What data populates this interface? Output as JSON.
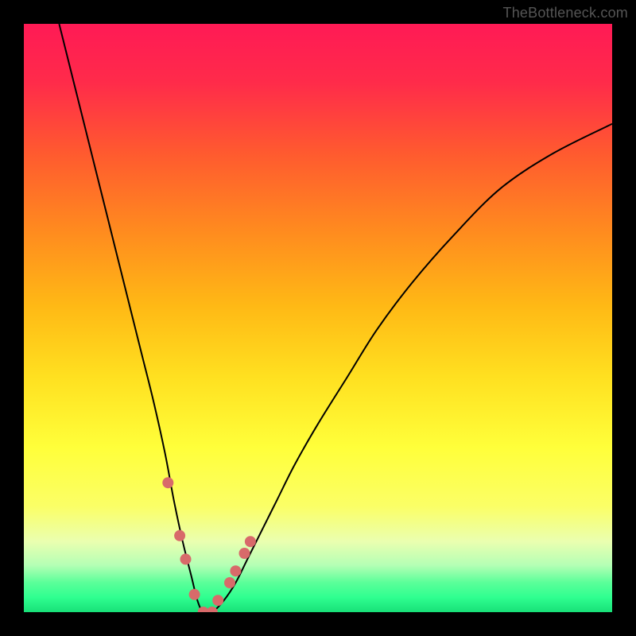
{
  "watermark": "TheBottleneck.com",
  "chart_data": {
    "type": "line",
    "title": "",
    "xlabel": "",
    "ylabel": "",
    "xlim": [
      0,
      100
    ],
    "ylim": [
      0,
      100
    ],
    "series": [
      {
        "name": "bottleneck-curve",
        "x": [
          6,
          8,
          10,
          12,
          14,
          16,
          18,
          20,
          22,
          24,
          25.5,
          27,
          28.5,
          29.5,
          30.5,
          32,
          34,
          36,
          38,
          40,
          43,
          46,
          50,
          55,
          60,
          66,
          73,
          81,
          90,
          100
        ],
        "y": [
          100,
          92,
          84,
          76,
          68,
          60,
          52,
          44,
          36,
          27,
          19,
          12,
          6,
          2,
          0,
          0,
          2,
          5,
          9,
          13,
          19,
          25,
          32,
          40,
          48,
          56,
          64,
          72,
          78,
          83
        ]
      }
    ],
    "markers": {
      "name": "bottleneck-points",
      "x": [
        24.5,
        26.5,
        27.5,
        29,
        30.5,
        32,
        33,
        35,
        36,
        37.5,
        38.5
      ],
      "y": [
        22,
        13,
        9,
        3,
        0,
        0,
        2,
        5,
        7,
        10,
        12
      ]
    },
    "gradient_stops": [
      {
        "offset": 0.0,
        "color": "#ff1a55"
      },
      {
        "offset": 0.1,
        "color": "#ff2b4a"
      },
      {
        "offset": 0.22,
        "color": "#ff5a2f"
      },
      {
        "offset": 0.35,
        "color": "#ff8a1f"
      },
      {
        "offset": 0.48,
        "color": "#ffb915"
      },
      {
        "offset": 0.6,
        "color": "#ffe020"
      },
      {
        "offset": 0.72,
        "color": "#ffff3a"
      },
      {
        "offset": 0.82,
        "color": "#fbff66"
      },
      {
        "offset": 0.88,
        "color": "#eaffb0"
      },
      {
        "offset": 0.92,
        "color": "#b5ffb5"
      },
      {
        "offset": 0.95,
        "color": "#5aff99"
      },
      {
        "offset": 0.975,
        "color": "#2fff90"
      },
      {
        "offset": 1.0,
        "color": "#18e078"
      }
    ],
    "marker_color": "#d86a6a"
  }
}
